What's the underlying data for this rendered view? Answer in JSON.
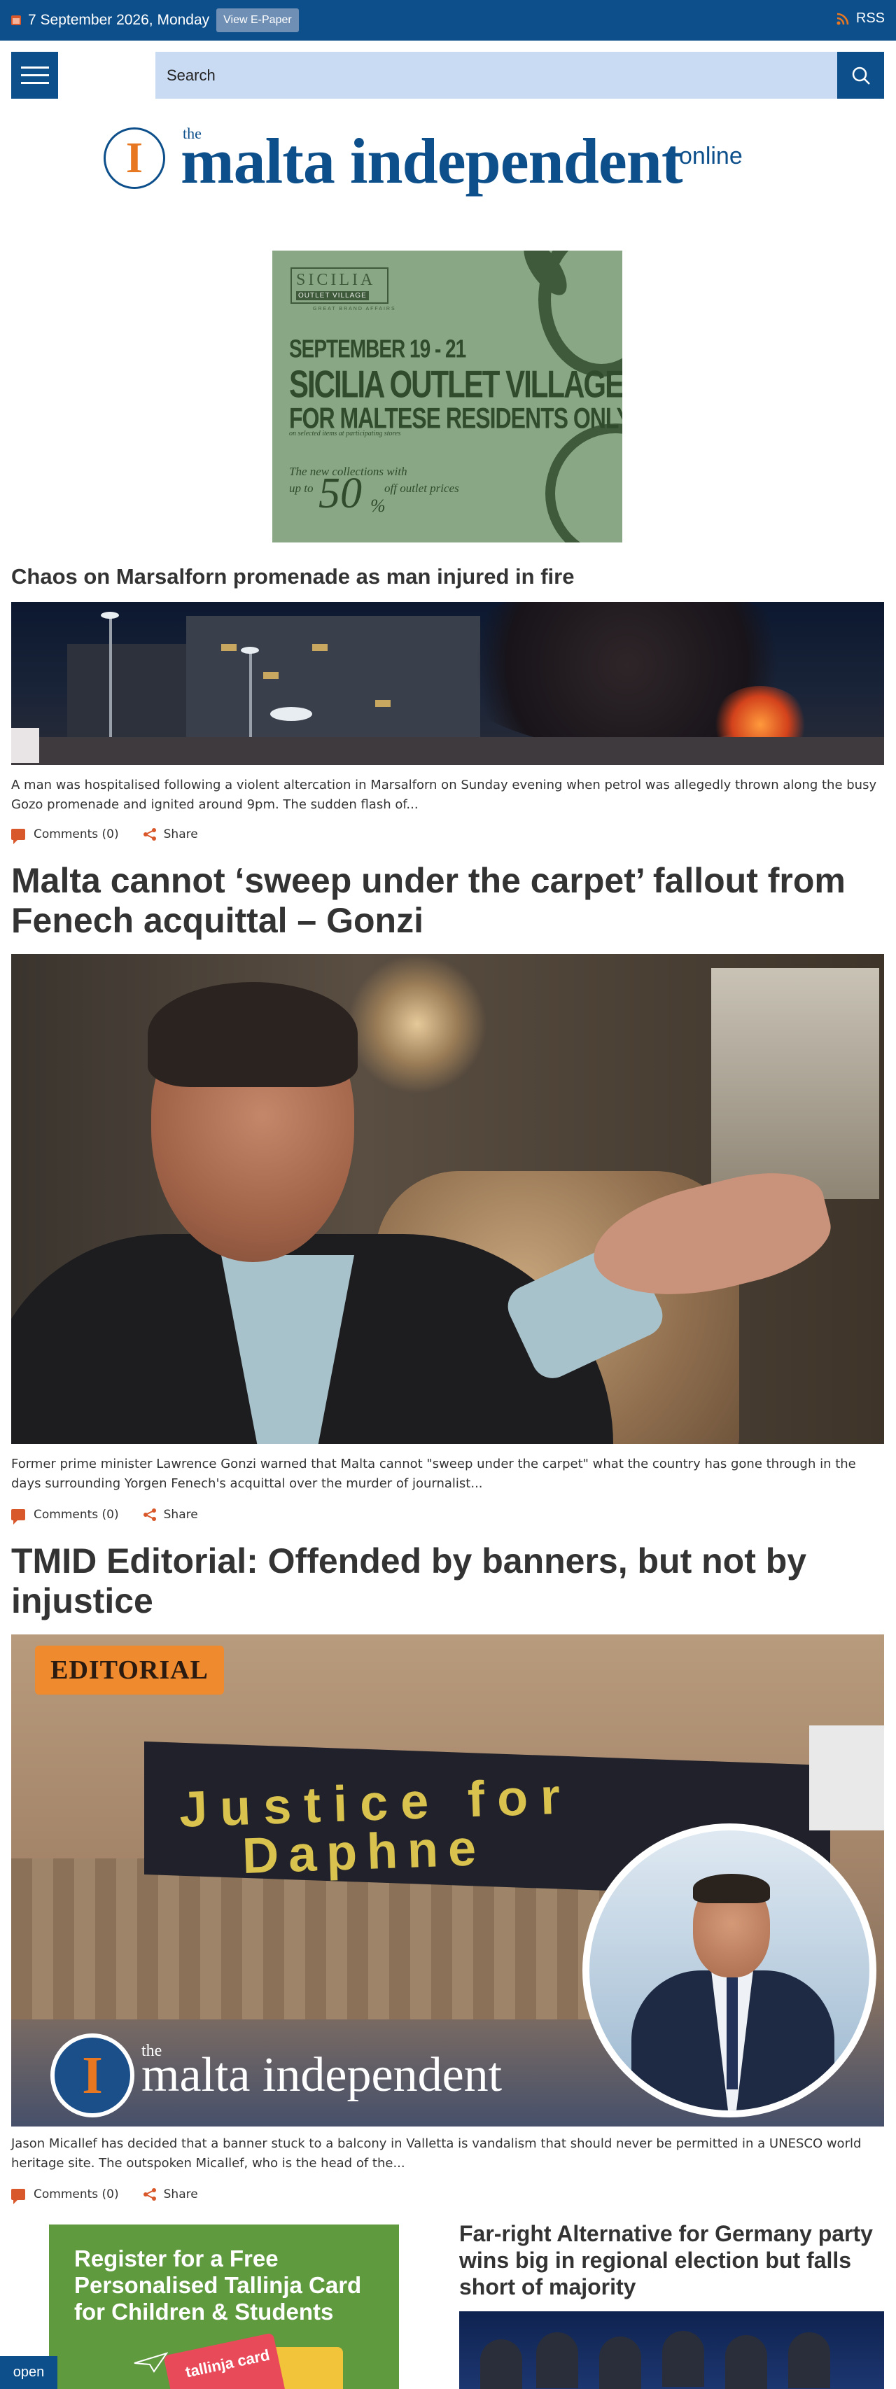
{
  "topbar": {
    "date": "7 September 2026, Monday",
    "epaper_label": "View E-Paper",
    "rss_label": "RSS"
  },
  "search": {
    "placeholder": "Search"
  },
  "logo": {
    "the": "the",
    "name": "malta independent",
    "suffix": "online",
    "mark": "I"
  },
  "ad": {
    "brand": "SICILIA",
    "brand_sub": "OUTLET VILLAGE",
    "brand_tiny": "GREAT BRAND AFFAIRS",
    "dates": "SEPTEMBER 19 - 21",
    "title": "SICILIA OUTLET VILLAGE",
    "subtitle": "FOR MALTESE RESIDENTS ONLY",
    "small": "on selected items at participating stores",
    "collections": "The new collections with",
    "upto": "up to",
    "discount": "50",
    "percent": "%",
    "outlet": "off outlet prices"
  },
  "articles": [
    {
      "title": "Chaos on Marsalforn promenade as man injured in fire",
      "excerpt": "A man was hospitalised following a violent altercation in Marsalforn on Sunday evening when petrol was allegedly thrown along the busy Gozo promenade and ignited around 9pm. The sudden flash of...",
      "comments": "Comments (0)",
      "share": "Share"
    },
    {
      "title": "Malta cannot ‘sweep under the carpet’ fallout from Fenech acquittal – Gonzi",
      "excerpt": "Former prime minister Lawrence Gonzi warned that Malta cannot \"sweep under the carpet\" what the country has gone through in the days surrounding Yorgen Fenech's acquittal over the murder of journalist...",
      "comments": "Comments (0)",
      "share": "Share"
    },
    {
      "title": "TMID Editorial: Offended by banners, but not by injustice",
      "excerpt": "Jason Micallef has decided that a banner stuck to a balcony in Valletta is vandalism that should never be permitted in a UNESCO world heritage site. The outspoken Micallef, who is the head of the...",
      "comments": "Comments (0)",
      "share": "Share",
      "image_badge": "EDITORIAL",
      "banner_line1": "Justice for",
      "banner_line2": "Daphne",
      "image_logo_the": "the",
      "image_logo_name": "malta independent"
    }
  ],
  "promo": {
    "line1": "Register for a Free",
    "line2": "Personalised Tallinja Card",
    "line3": "for Children & Students",
    "card_label": "tallinja card"
  },
  "side_article": {
    "title": "Far-right Alternative for Germany party wins big in regional election but falls short of majority"
  },
  "open_tab": "open",
  "colors": {
    "brand_blue": "#0d4f8b",
    "accent_orange": "#d9582b",
    "search_bg": "#c9daf3"
  }
}
